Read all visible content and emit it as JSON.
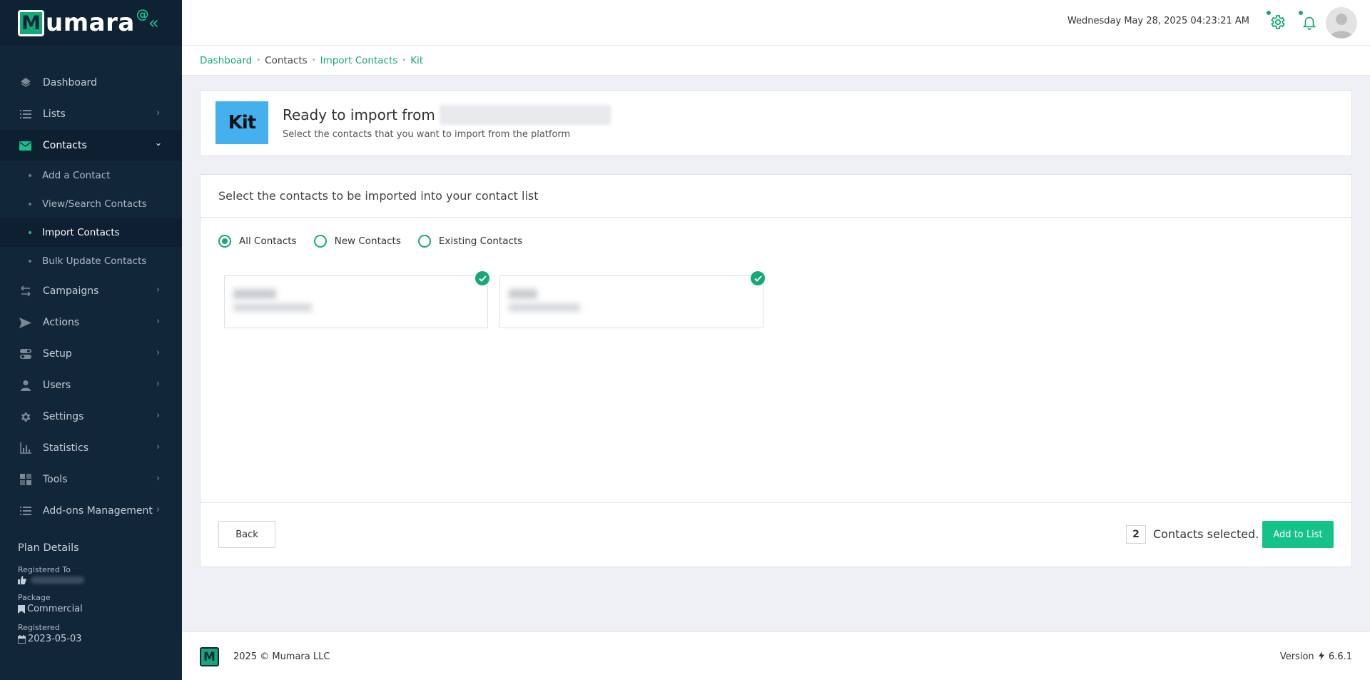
{
  "logo": {
    "letter": "M",
    "text": "umara",
    "at": "@"
  },
  "sidebar": {
    "items": [
      {
        "label": "Dashboard",
        "icon": "dashboard-icon"
      },
      {
        "label": "Lists",
        "icon": "list-icon"
      },
      {
        "label": "Contacts",
        "icon": "envelope-icon"
      },
      {
        "label": "Campaigns",
        "icon": "arrows-icon"
      },
      {
        "label": "Actions",
        "icon": "send-icon"
      },
      {
        "label": "Setup",
        "icon": "toggle-icon"
      },
      {
        "label": "Users",
        "icon": "user-icon"
      },
      {
        "label": "Settings",
        "icon": "gear-icon"
      },
      {
        "label": "Statistics",
        "icon": "chart-icon"
      },
      {
        "label": "Tools",
        "icon": "tools-icon"
      },
      {
        "label": "Add-ons Management",
        "icon": "list-icon"
      }
    ],
    "contacts_sub": [
      {
        "label": "Add a Contact"
      },
      {
        "label": "View/Search Contacts"
      },
      {
        "label": "Import Contacts"
      },
      {
        "label": "Bulk Update Contacts"
      }
    ],
    "plan": {
      "title": "Plan Details",
      "registered_to_label": "Registered To",
      "package_label": "Package",
      "package_value": "Commercial",
      "registered_label": "Registered",
      "registered_value": "2023-05-03"
    }
  },
  "header": {
    "datetime": "Wednesday May 28, 2025 04:23:21 AM"
  },
  "breadcrumb": {
    "dashboard": "Dashboard",
    "contacts": "Contacts",
    "import_contacts": "Import Contacts",
    "kit": "Kit"
  },
  "ready": {
    "logo_text": "Kit",
    "title": "Ready to import from",
    "subtitle": "Select the contacts that you want to import from the platform"
  },
  "select": {
    "heading": "Select the contacts to be imported into your contact list",
    "filters": [
      {
        "label": "All Contacts",
        "checked": true
      },
      {
        "label": "New Contacts",
        "checked": false
      },
      {
        "label": "Existing Contacts",
        "checked": false
      }
    ],
    "back_label": "Back",
    "selected_count": "2",
    "selected_label": "Contacts selected.",
    "add_label": "Add to List"
  },
  "footer": {
    "logo_letter": "M",
    "copyright": "2025 © Mumara LLC",
    "version_label": "Version",
    "version_number": "6.6.1"
  },
  "colors": {
    "accent": "#15a878",
    "accent_bright": "#15c28a",
    "sidebar_bg": "#12263a",
    "kit_blue": "#44b0ee"
  }
}
